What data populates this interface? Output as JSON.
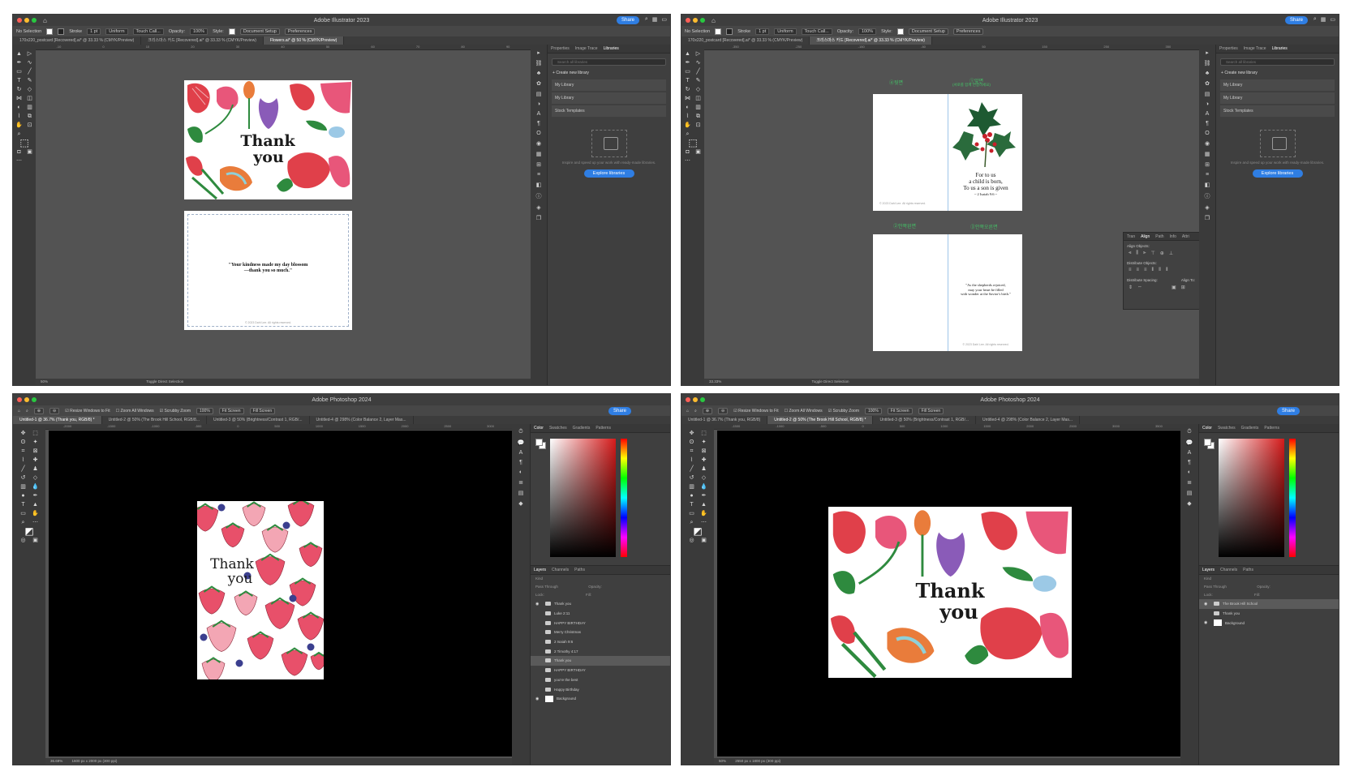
{
  "illustrator": {
    "app_title": "Adobe Illustrator 2023",
    "share_label": "Share",
    "control": {
      "no_selection": "No Selection",
      "stroke_label": "Stroke",
      "stroke_value": "1 pt",
      "profile": "Uniform",
      "brush": "Touch Call...",
      "opacity_label": "Opacity:",
      "opacity_value": "100%",
      "style_label": "Style:",
      "document_setup": "Document Setup",
      "preferences": "Preferences"
    },
    "panel_tabs": [
      "Properties",
      "Image Trace",
      "Libraries"
    ],
    "libraries": {
      "search_placeholder": "Search all libraries",
      "create_new": "Create new library",
      "items": [
        "My Library",
        "My Library",
        "Stock Templates"
      ],
      "description": "Inspire and speed up your work with ready-made libraries.",
      "explore_button": "Explore libraries"
    }
  },
  "window1": {
    "tabs": [
      "170x220_postcard [Recovered].ai* @ 33.33 % (CMYK/Preview)",
      "크리스마스 카드 [Recovered].ai* @ 33.33 % (CMYK/Preview)",
      "Flowers.ai* @ 50 % (CMYK/Preview)"
    ],
    "card_title_line1": "Thank",
    "card_title_line2": "you",
    "quote_line1": "\"Your kindness made my day blossom",
    "quote_line2": "—thank you so much.\"",
    "copyright": "© 2023 Dahl Lee. All rights reserved.",
    "status_zoom": "50%",
    "status_mode": "Toggle Direct Selection"
  },
  "window2": {
    "tabs": [
      "170x220_postcard [Recovered].ai* @ 33.33 % (CMYK/Preview)",
      "크리스마스 카드 [Recovered].ai* @ 33.33 % (CMYK/Preview)"
    ],
    "label_back": "④뒷면",
    "label_front": "①앞면",
    "label_front_note": "(서로를 함께 연결하세요)",
    "label_inside_left": "②안쪽왼면",
    "label_inside_right": "③안쪽오른면",
    "verse_line1": "For to us",
    "verse_line2": "a child is born,",
    "verse_line3": "To us a son is given",
    "verse_ref": "~ 2 Isaiah 9:6 ~",
    "inside_line1": "\"As the shepherds rejoiced,",
    "inside_line2": "may your heart be filled",
    "inside_line3": "with wonder at the Savior's birth.\"",
    "copyright": "© 2023 Dahl Lee. All rights reserved.",
    "status_zoom": "33.33%",
    "status_mode": "Toggle Direct Selection",
    "align_panel": {
      "tabs": [
        "Tran",
        "Align",
        "Path",
        "Info",
        "Attri"
      ],
      "align_objects": "Align Objects:",
      "distribute_objects": "Distribute Objects:",
      "distribute_spacing": "Distribute Spacing:",
      "align_to": "Align To:"
    }
  },
  "photoshop": {
    "app_title": "Adobe Photoshop 2024",
    "share_label": "Share",
    "options": {
      "resize_windows": "Resize Windows to Fit",
      "zoom_all": "Zoom All Windows",
      "scrubby_zoom": "Scrubby Zoom",
      "zoom_value": "100%",
      "fit_screen": "Fit Screen",
      "fill_screen": "Fill Screen"
    },
    "color_tabs": [
      "Color",
      "Swatches",
      "Gradients",
      "Patterns"
    ],
    "layer_tabs": [
      "Layers",
      "Channels",
      "Paths"
    ],
    "kind_label": "Kind",
    "blend_mode": "Pass Through",
    "opacity_label": "Opacity:",
    "fill_label": "Fill:",
    "lock_label": "Lock:"
  },
  "window3": {
    "tabs": [
      "Untitled-1 @ 36.7% (Thank you, RGB/8) *",
      "Untitled-2 @ 50% (The Brook Hill School, RGB/8...",
      "Untitled-3 @ 50% (Brightness/Contrast 1, RGB/...",
      "Untitled-4 @ 298% (Color Balance 2, Layer Mas..."
    ],
    "card_title_line1": "Thank",
    "card_title_line2": "you",
    "layers": [
      "Thank you",
      "Luke 2:11",
      "HAPPY BIRTHDAY",
      "Merry Christmas",
      "2 Isaiah 9:6",
      "2 Timothy 4:17",
      "Thank you",
      "HAPPY BIRTHDAY",
      "you're the best",
      "Happy Birthday",
      "Background"
    ],
    "selected_layer_index": 6,
    "status_zoom": "36.69%",
    "status_size": "1600 px x 2000 px (300 ppi)"
  },
  "window4": {
    "tabs": [
      "Untitled-1 @ 36.7% (Thank you, RGB/8)",
      "Untitled-2 @ 50% (The Brook Hill School, RGB/8) *",
      "Untitled-3 @ 50% (Brightness/Contrast 1, RGB/...",
      "Untitled-4 @ 298% (Color Balance 2, Layer Mas..."
    ],
    "card_title_line1": "Thank",
    "card_title_line2": "you",
    "layers": [
      "The Brook Hill School",
      "Thank you",
      "Background"
    ],
    "selected_layer_index": 0,
    "status_zoom": "50%",
    "status_size": "2550 px x 1800 px (300 ppi)"
  },
  "colors": {
    "share_blue": "#2f7ee3",
    "korean_label_green": "#44c267",
    "flower_red": "#e0404a",
    "flower_pink": "#e8567a",
    "leaf_green": "#2e8a3e",
    "strawberry_red": "#e8506a",
    "blueberry": "#3b3f8f"
  }
}
